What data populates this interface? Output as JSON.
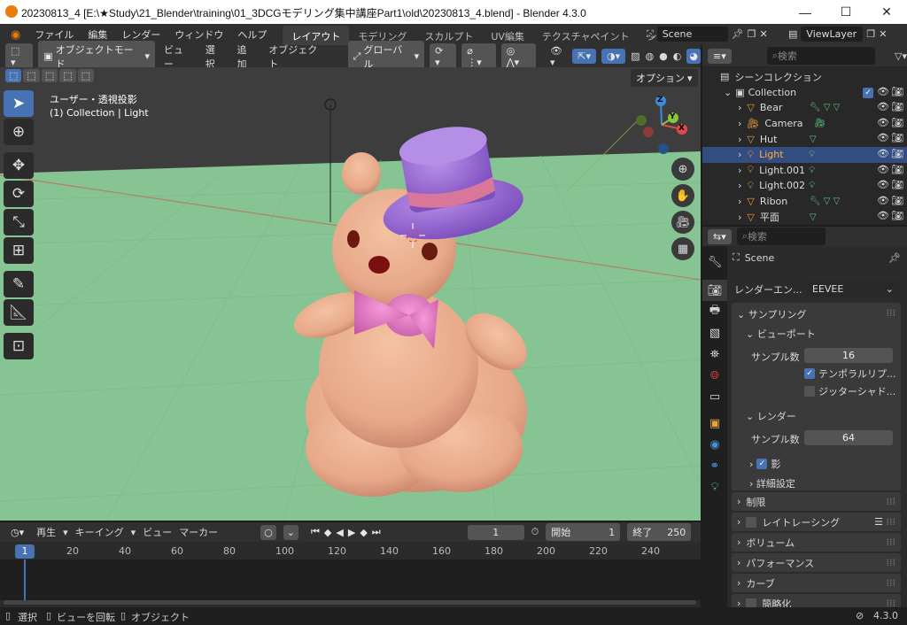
{
  "window": {
    "title": "20230813_4 [E:\\★Study\\21_Blender\\training\\01_3DCGモデリング集中講座Part1\\old\\20230813_4.blend] - Blender 4.3.0",
    "minimize": "—",
    "maximize": "☐",
    "close": "✕"
  },
  "menu": [
    "ファイル",
    "編集",
    "レンダー",
    "ウィンドウ",
    "ヘルプ"
  ],
  "workspaces": [
    "レイアウト",
    "モデリング",
    "スカルプト",
    "UV編集",
    "テクスチャペイント",
    "シェーディ"
  ],
  "scene_name": "Scene",
  "viewlayer_name": "ViewLayer",
  "viewport_header": {
    "mode": "オブジェクトモード",
    "menus": [
      "ビュー",
      "選択",
      "追加",
      "オブジェクト"
    ],
    "transform": "グローバル",
    "options": "オプション"
  },
  "viewport": {
    "view_name": "ユーザー・透視投影",
    "view_info": "(1) Collection | Light",
    "gizmo": {
      "x": "X",
      "y": "Y",
      "z": "Z"
    }
  },
  "outliner": {
    "search_placeholder": "検索",
    "root": "シーンコレクション",
    "collection": "Collection",
    "items": [
      {
        "name": "Bear",
        "selected": false
      },
      {
        "name": "Camera",
        "selected": false
      },
      {
        "name": "Hut",
        "selected": false
      },
      {
        "name": "Light",
        "selected": true
      },
      {
        "name": "Light.001",
        "selected": false
      },
      {
        "name": "Light.002",
        "selected": false
      },
      {
        "name": "Ribon",
        "selected": false
      },
      {
        "name": "平面",
        "selected": false
      }
    ]
  },
  "properties": {
    "search_placeholder": "検索",
    "scene": "Scene",
    "render_engine_label": "レンダーエン...",
    "render_engine": "EEVEE",
    "sampling": "サンプリング",
    "viewport_section": "ビューポート",
    "viewport_samples_label": "サンプル数",
    "viewport_samples": "16",
    "temporal": "テンポラルリプ...",
    "jitter": "ジッターシャド...",
    "render_section": "レンダー",
    "render_samples_label": "サンプル数",
    "render_samples": "64",
    "shadows": "影",
    "advanced": "詳細設定",
    "sections": [
      "制限",
      "レイトレーシング",
      "ボリューム",
      "パフォーマンス",
      "カーブ",
      "簡略化"
    ]
  },
  "timeline": {
    "menus": [
      "再生",
      "キーイング",
      "ビュー",
      "マーカー"
    ],
    "current_frame": "1",
    "start_label": "開始",
    "start": "1",
    "end_label": "終了",
    "end": "250",
    "ticks": [
      "20",
      "40",
      "60",
      "80",
      "100",
      "120",
      "140",
      "160",
      "180",
      "200",
      "220",
      "240"
    ],
    "playhead": "1"
  },
  "status": {
    "select": "選択",
    "rotate": "ビューを回転",
    "object": "オブジェクト",
    "version": "4.3.0"
  },
  "colors": {
    "accent": "#4772b3",
    "floor": "#87c493",
    "hat": "#9a6fd6",
    "bear": "#e6ab8a",
    "bow": "#e27fc9"
  }
}
